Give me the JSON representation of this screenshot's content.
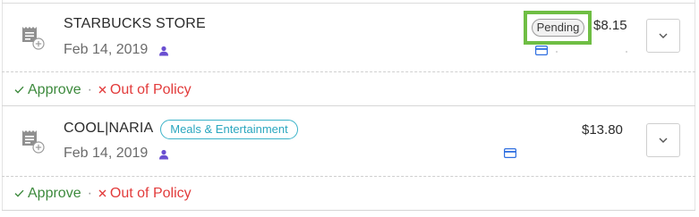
{
  "expenses": [
    {
      "merchant": "STARBUCKS STORE",
      "date": "Feb 14, 2019",
      "status": "Pending",
      "amount": "$8.15",
      "category": "",
      "actions": {
        "approve": "Approve",
        "separator": "·",
        "out_of_policy": "Out of Policy"
      }
    },
    {
      "merchant": "COOL|NARIA",
      "date": "Feb 14, 2019",
      "status": "",
      "amount": "$13.80",
      "category": "Meals & Entertainment",
      "actions": {
        "approve": "Approve",
        "separator": "·",
        "out_of_policy": "Out of Policy"
      }
    }
  ],
  "icons": {
    "receipt": "receipt-add-icon",
    "submitter": "person-icon",
    "payment": "credit-card-icon",
    "expand": "chevron-down-icon",
    "approve_mark": "check-icon",
    "policy_mark": "x-icon"
  },
  "colors": {
    "highlight": "#6fbe44",
    "approve": "#3d8a3d",
    "out_of_policy": "#e23b3b",
    "category": "#2aa6bf",
    "person": "#6a4fd1",
    "card": "#2f6fe0"
  }
}
